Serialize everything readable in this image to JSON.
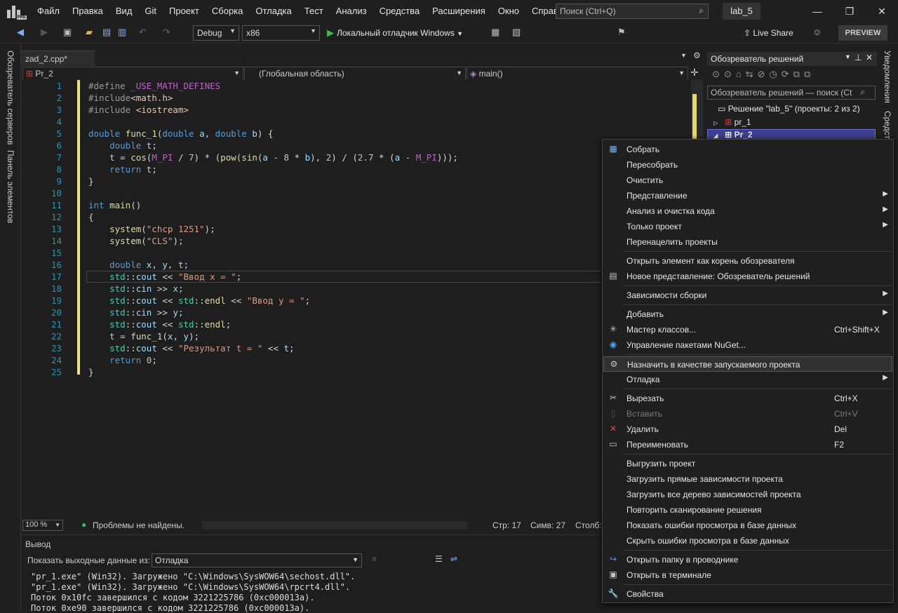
{
  "menubar": {
    "items": [
      "Файл",
      "Правка",
      "Вид",
      "Git",
      "Проект",
      "Сборка",
      "Отладка",
      "Тест",
      "Анализ",
      "Средства",
      "Расширения",
      "Окно",
      "Справка"
    ],
    "search_placeholder": "Поиск (Ctrl+Q)",
    "solution_name": "lab_5",
    "logo_badge": "PRE"
  },
  "toolbar": {
    "config": "Debug",
    "platform": "x86",
    "debugger": "Локальный отладчик Windows",
    "live_share": "Live Share",
    "preview": "PREVIEW"
  },
  "side_panels": {
    "left_top": "Обозреватель серверов",
    "left_bottom": "Панель элементов",
    "right_top": "Уведомления",
    "right_bottom": "Средства"
  },
  "editor": {
    "tab_label": "zad_2.cpp*",
    "project_combo": "Pr_2",
    "scope_combo": "(Глобальная область)",
    "member_combo": "main()",
    "zoom": "100 %",
    "problems": "Проблемы не найдены.",
    "line_status": "Стр: 17",
    "char_status": "Симв: 27",
    "col_status": "Столб:",
    "lines": [
      {
        "n": "1",
        "html": "<span class='pp'>#define </span><span class='mac'>_USE_MATH_DEFINES</span>"
      },
      {
        "n": "2",
        "html": "<span class='pp'>#include</span><span class='inc'>&lt;math.h&gt;</span>"
      },
      {
        "n": "3",
        "html": "<span class='pp'>#include </span><span class='inc'>&lt;iostream&gt;</span>"
      },
      {
        "n": "4",
        "html": ""
      },
      {
        "n": "5",
        "html": "<span class='ty'>double</span> <span class='fn'>func_1</span>(<span class='ty'>double</span> <span class='id'>a</span>, <span class='ty'>double</span> <span class='id'>b</span>) {"
      },
      {
        "n": "6",
        "html": "    <span class='ty'>double</span> <span class='id'>t</span>;"
      },
      {
        "n": "7",
        "html": "    <span class='id'>t</span> = <span class='fn'>cos</span>(<span class='mac'>M_PI</span> / <span class='num'>7</span>) * (<span class='fn'>pow</span>(<span class='fn'>sin</span>(<span class='id'>a</span> - <span class='num'>8</span> * <span class='id'>b</span>), <span class='num'>2</span>) / (<span class='num'>2.7</span> * (<span class='id'>a</span> - <span class='mac'>M_PI</span>)));"
      },
      {
        "n": "8",
        "html": "    <span class='kw'>return</span> <span class='id'>t</span>;"
      },
      {
        "n": "9",
        "html": "}"
      },
      {
        "n": "10",
        "html": ""
      },
      {
        "n": "11",
        "html": "<span class='ty'>int</span> <span class='fn'>main</span>()"
      },
      {
        "n": "12",
        "html": "{"
      },
      {
        "n": "13",
        "html": "    <span class='fn'>system</span>(<span class='str'>\"chcp 1251\"</span>);"
      },
      {
        "n": "14",
        "html": "    <span class='fn'>system</span>(<span class='str'>\"CLS\"</span>);"
      },
      {
        "n": "15",
        "html": ""
      },
      {
        "n": "16",
        "html": "    <span class='ty'>double</span> <span class='id'>x</span>, <span class='id'>y</span>, <span class='id'>t</span>;"
      },
      {
        "n": "17",
        "html": "    <span class='ns'>std</span>::<span class='id'>cout</span> &lt;&lt; <span class='str'>\"Ввод x = \"</span>;"
      },
      {
        "n": "18",
        "html": "    <span class='ns'>std</span>::<span class='id'>cin</span> &gt;&gt; <span class='id'>x</span>;"
      },
      {
        "n": "19",
        "html": "    <span class='ns'>std</span>::<span class='id'>cout</span> &lt;&lt; <span class='ns'>std</span>::<span class='fn'>endl</span> &lt;&lt; <span class='str'>\"Ввод y = \"</span>;"
      },
      {
        "n": "20",
        "html": "    <span class='ns'>std</span>::<span class='id'>cin</span> &gt;&gt; <span class='id'>y</span>;"
      },
      {
        "n": "21",
        "html": "    <span class='ns'>std</span>::<span class='id'>cout</span> &lt;&lt; <span class='ns'>std</span>::<span class='fn'>endl</span>;"
      },
      {
        "n": "22",
        "html": "    <span class='id'>t</span> = <span class='fn'>func_1</span>(<span class='id'>x</span>, <span class='id'>y</span>);"
      },
      {
        "n": "23",
        "html": "    <span class='ns'>std</span>::<span class='id'>cout</span> &lt;&lt; <span class='str'>\"Результат t = \"</span> &lt;&lt; <span class='id'>t</span>;"
      },
      {
        "n": "24",
        "html": "    <span class='kw'>return</span> <span class='num'>0</span>;"
      },
      {
        "n": "25",
        "html": "}"
      }
    ]
  },
  "output": {
    "title": "Вывод",
    "source_label": "Показать выходные данные из:",
    "source_value": "Отладка",
    "lines": [
      "\"pr_1.exe\" (Win32). Загружено \"C:\\Windows\\SysWOW64\\sechost.dll\".",
      "\"pr_1.exe\" (Win32). Загружено \"C:\\Windows\\SysWOW64\\rpcrt4.dll\".",
      "Поток 0x10fc завершился с кодом 3221225786 (0xc000013a).",
      "Поток 0xe90 завершился с кодом 3221225786 (0xc000013a)."
    ]
  },
  "solution_explorer": {
    "title": "Обозреватель решений",
    "search_placeholder": "Обозреватель решений — поиск (Ct",
    "solution": "Решение \"lab_5\" (проекты: 2 из 2)",
    "project1": "pr_1",
    "project2": "Pr_2"
  },
  "context_menu": {
    "items": [
      {
        "label": "Собрать",
        "icon": "build-icon",
        "shortcut": "",
        "submenu": false
      },
      {
        "label": "Пересобрать",
        "icon": "",
        "shortcut": "",
        "submenu": false
      },
      {
        "label": "Очистить",
        "icon": "",
        "shortcut": "",
        "submenu": false
      },
      {
        "label": "Представление",
        "icon": "",
        "shortcut": "",
        "submenu": true
      },
      {
        "label": "Анализ и очистка кода",
        "icon": "",
        "shortcut": "",
        "submenu": true
      },
      {
        "label": "Только проект",
        "icon": "",
        "shortcut": "",
        "submenu": true
      },
      {
        "label": "Перенацелить проекты",
        "icon": "",
        "shortcut": "",
        "submenu": false
      },
      {
        "sep": true
      },
      {
        "label": "Открыть элемент как корень обозревателя",
        "icon": "",
        "shortcut": "",
        "submenu": false
      },
      {
        "label": "Новое представление: Обозреватель решений",
        "icon": "new-view-icon",
        "shortcut": "",
        "submenu": false
      },
      {
        "sep": true
      },
      {
        "label": "Зависимости сборки",
        "icon": "",
        "shortcut": "",
        "submenu": true
      },
      {
        "sep": true
      },
      {
        "label": "Добавить",
        "icon": "",
        "shortcut": "",
        "submenu": true
      },
      {
        "label": "Мастер классов...",
        "icon": "class-wizard-icon",
        "shortcut": "Ctrl+Shift+X",
        "submenu": false
      },
      {
        "label": "Управление пакетами NuGet...",
        "icon": "nuget-icon",
        "shortcut": "",
        "submenu": false
      },
      {
        "sep": true
      },
      {
        "label": "Назначить в качестве запускаемого проекта",
        "icon": "gear-icon",
        "shortcut": "",
        "submenu": false,
        "highlight": true
      },
      {
        "label": "Отладка",
        "icon": "",
        "shortcut": "",
        "submenu": true
      },
      {
        "sep": true
      },
      {
        "label": "Вырезать",
        "icon": "cut-icon",
        "shortcut": "Ctrl+X",
        "submenu": false
      },
      {
        "label": "Вставить",
        "icon": "paste-icon",
        "shortcut": "Ctrl+V",
        "submenu": false,
        "disabled": true
      },
      {
        "label": "Удалить",
        "icon": "delete-icon",
        "shortcut": "Del",
        "submenu": false
      },
      {
        "label": "Переименовать",
        "icon": "rename-icon",
        "shortcut": "F2",
        "submenu": false
      },
      {
        "sep": true
      },
      {
        "label": "Выгрузить проект",
        "icon": "",
        "shortcut": "",
        "submenu": false
      },
      {
        "label": "Загрузить прямые зависимости проекта",
        "icon": "",
        "shortcut": "",
        "submenu": false
      },
      {
        "label": "Загрузить все дерево зависимостей проекта",
        "icon": "",
        "shortcut": "",
        "submenu": false
      },
      {
        "label": "Повторить сканирование решения",
        "icon": "",
        "shortcut": "",
        "submenu": false
      },
      {
        "label": "Показать ошибки просмотра в базе данных",
        "icon": "",
        "shortcut": "",
        "submenu": false
      },
      {
        "label": "Скрыть ошибки просмотра в базе данных",
        "icon": "",
        "shortcut": "",
        "submenu": false
      },
      {
        "sep": true
      },
      {
        "label": "Открыть папку в проводнике",
        "icon": "open-folder-icon",
        "shortcut": "",
        "submenu": false
      },
      {
        "label": "Открыть в терминале",
        "icon": "terminal-icon",
        "shortcut": "",
        "submenu": false
      },
      {
        "sep": true
      },
      {
        "label": "Свойства",
        "icon": "wrench-icon",
        "shortcut": "",
        "submenu": false
      }
    ]
  }
}
